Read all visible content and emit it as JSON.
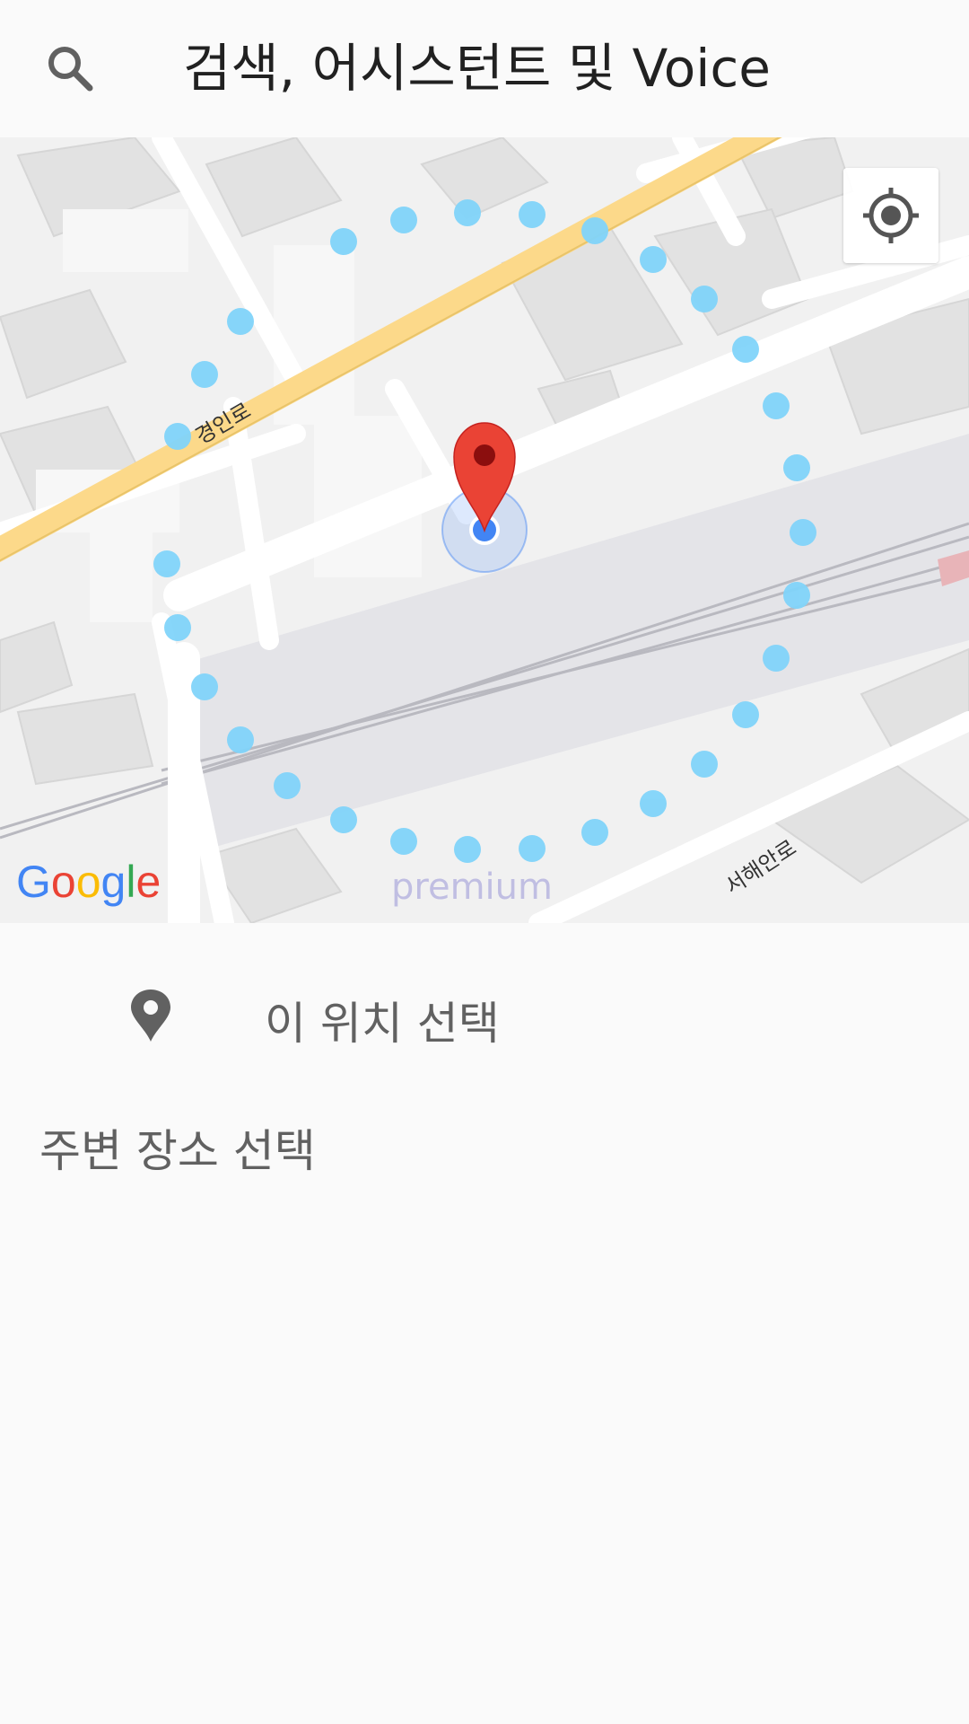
{
  "header": {
    "title": "검색, 어시스턴트 및 Voice",
    "search_icon": "search-icon"
  },
  "map": {
    "road_labels": {
      "gyeongin": "경인로",
      "seohae": "서해안로"
    },
    "google_logo": "Google",
    "watermark": "premium",
    "locate_icon": "my-location-icon",
    "marker_icon": "red-map-pin",
    "colors": {
      "major_road": "#fcd98a",
      "location_dot": "#4285f4",
      "pin": "#ea4335",
      "path_dots": "#81d4fa"
    }
  },
  "select_location": {
    "label": "이 위치 선택",
    "icon": "place-pin-icon"
  },
  "nearby": {
    "heading": "주변 장소 선택"
  }
}
